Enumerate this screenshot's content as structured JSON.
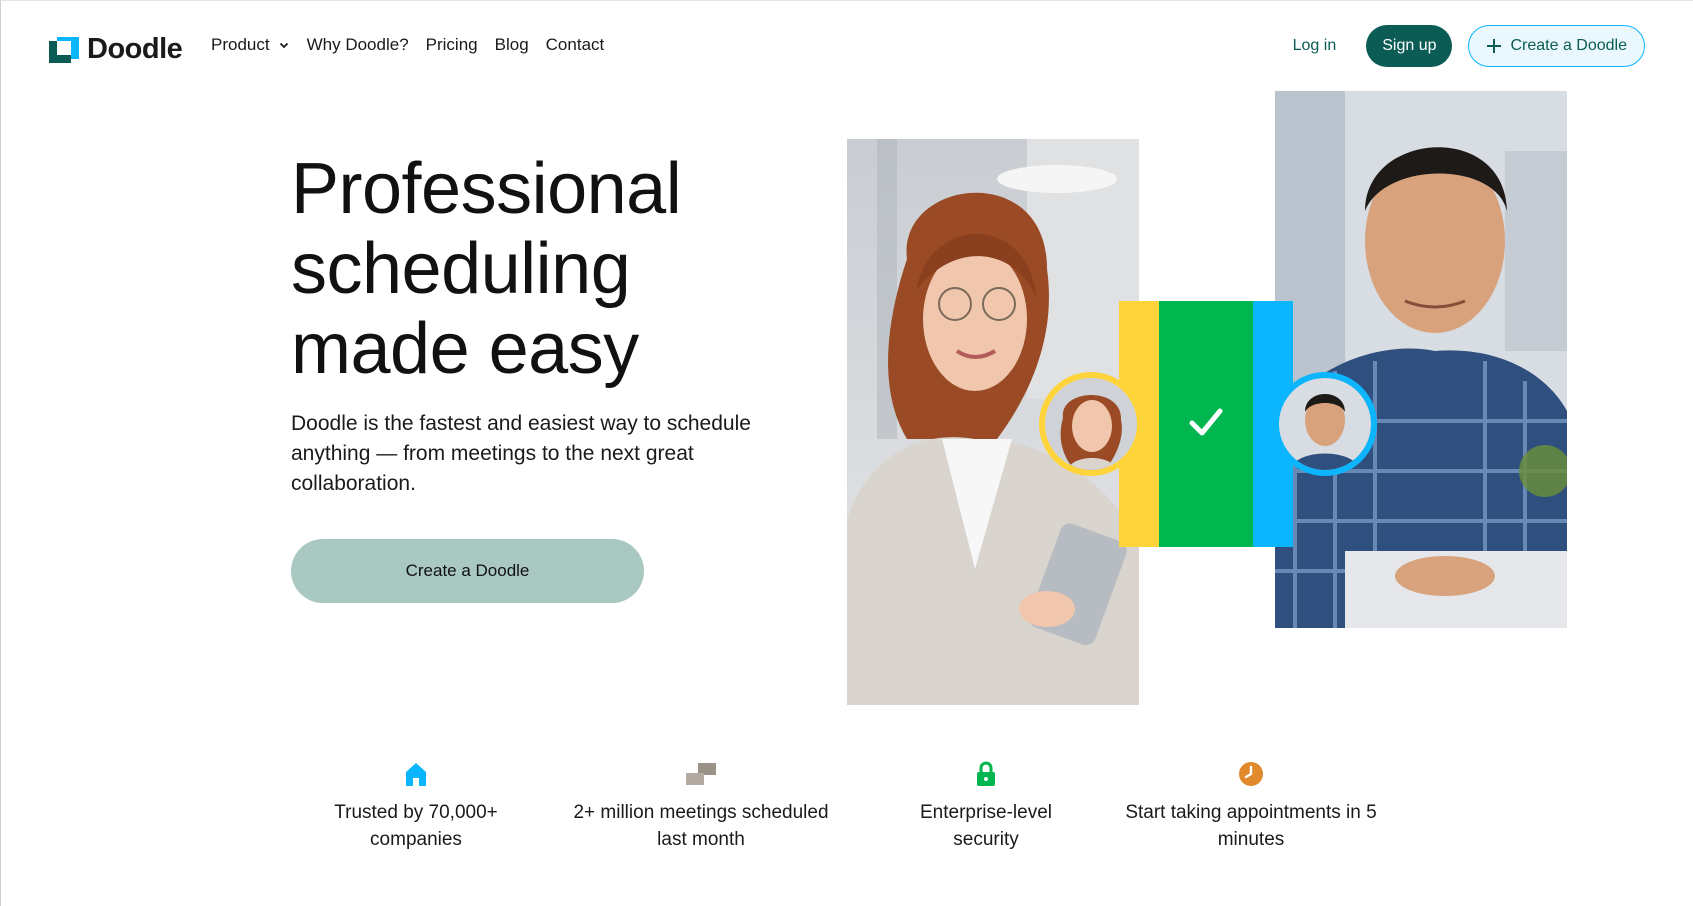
{
  "brand": {
    "name": "Doodle"
  },
  "nav": {
    "links": [
      {
        "label": "Product",
        "has_dropdown": true
      },
      {
        "label": "Why Doodle?"
      },
      {
        "label": "Pricing"
      },
      {
        "label": "Blog"
      },
      {
        "label": "Contact"
      }
    ],
    "login_label": "Log in",
    "signup_label": "Sign up",
    "create_label": "Create a Doodle"
  },
  "hero": {
    "title_lines": [
      "Professional",
      "scheduling",
      "made easy"
    ],
    "subtitle": "Doodle is the fastest and easiest way to schedule anything — from meetings to the next great collaboration.",
    "cta_label": "Create a Doodle"
  },
  "features": [
    {
      "icon": "building-icon",
      "text": "Trusted by 70,000+ companies",
      "color": "#0bb6ff"
    },
    {
      "icon": "calendar-blocks-icon",
      "text": "2+ million meetings scheduled last month",
      "color": "#9b9287"
    },
    {
      "icon": "lock-icon",
      "text": "Enterprise-level security",
      "color": "#00b64f"
    },
    {
      "icon": "clock-icon",
      "text": "Start taking appointments in 5 minutes",
      "color": "#e08a2c"
    }
  ],
  "colors": {
    "brand_dark": "#0a5c55",
    "brand_blue": "#0bb6ff",
    "yellow": "#ffd43b",
    "green": "#00b64f",
    "cta_bg": "#a9c8c2"
  }
}
